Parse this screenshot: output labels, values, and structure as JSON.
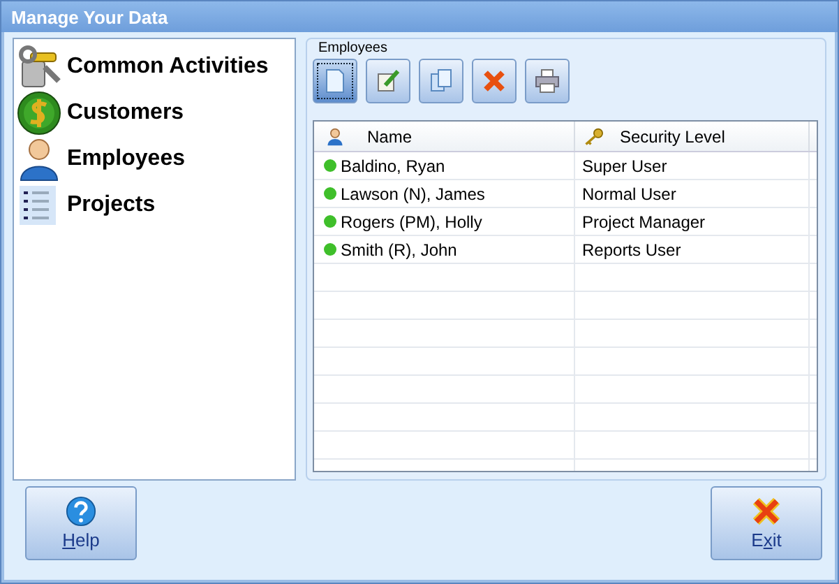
{
  "window": {
    "title": "Manage Your Data"
  },
  "sidebar": {
    "items": [
      {
        "kind": "tools",
        "label": "Common Activities"
      },
      {
        "kind": "money",
        "label": "Customers"
      },
      {
        "kind": "person",
        "label": "Employees"
      },
      {
        "kind": "list",
        "label": "Projects"
      }
    ]
  },
  "group": {
    "title": "Employees",
    "toolbar": [
      {
        "kind": "new",
        "focused": true
      },
      {
        "kind": "edit",
        "focused": false
      },
      {
        "kind": "copy",
        "focused": false
      },
      {
        "kind": "delete",
        "focused": false
      },
      {
        "kind": "print",
        "focused": false
      }
    ],
    "table": {
      "columns": [
        {
          "kind": "person",
          "label": "Name"
        },
        {
          "kind": "key",
          "label": "Security Level"
        }
      ],
      "rows": [
        {
          "active": true,
          "name": "Baldino, Ryan",
          "level": "Super User"
        },
        {
          "active": true,
          "name": "Lawson (N), James",
          "level": "Normal User"
        },
        {
          "active": true,
          "name": "Rogers (PM), Holly",
          "level": "Project Manager"
        },
        {
          "active": true,
          "name": "Smith (R), John",
          "level": "Reports User"
        }
      ]
    }
  },
  "buttons": [
    {
      "kind": "help",
      "label": [
        {
          "text": "H",
          "underlined": true
        },
        {
          "text": "elp",
          "underlined": false
        }
      ]
    },
    {
      "kind": "exit",
      "label": [
        {
          "text": "E",
          "underlined": false
        },
        {
          "text": "x",
          "underlined": true
        },
        {
          "text": "it",
          "underlined": false
        }
      ]
    }
  ]
}
